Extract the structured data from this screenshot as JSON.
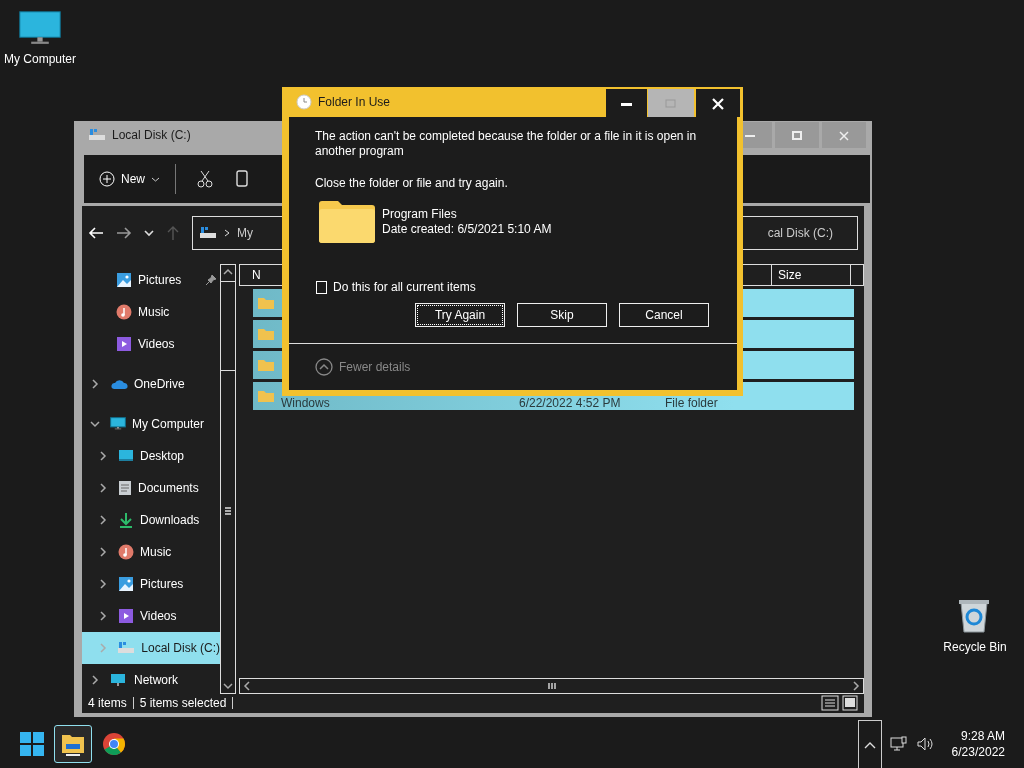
{
  "desktop_icons": [
    {
      "kind": "computer",
      "label": "My Computer"
    },
    {
      "kind": "recycle",
      "label": "Recycle Bin"
    }
  ],
  "explorer": {
    "title": "Local Disk (C:)",
    "toolbar": [
      {
        "kind": "new",
        "label": "New"
      },
      {
        "kind": "cut"
      },
      {
        "kind": "copy"
      }
    ],
    "address": {
      "left": "My",
      "right": "cal Disk (C:)"
    },
    "nav": [
      {
        "kind": "pictures",
        "label": "Pictures",
        "pinned": true,
        "selected": false
      },
      {
        "kind": "music",
        "label": "Music",
        "pinned": false,
        "selected": false
      },
      {
        "kind": "videos",
        "label": "Videos",
        "pinned": false,
        "selected": false
      },
      {
        "kind": "cloud",
        "label": "OneDrive",
        "expanded": false,
        "selected": false
      },
      {
        "kind": "computer",
        "label": "My Computer",
        "expanded": true,
        "selected": false,
        "children": [
          {
            "kind": "desktop",
            "label": "Desktop",
            "expanded": false,
            "selected": false
          },
          {
            "kind": "documents",
            "label": "Documents",
            "expanded": false,
            "selected": false
          },
          {
            "kind": "downloads",
            "label": "Downloads",
            "expanded": false,
            "selected": false
          },
          {
            "kind": "music",
            "label": "Music",
            "expanded": false,
            "selected": false
          },
          {
            "kind": "pictures",
            "label": "Pictures",
            "expanded": false,
            "selected": false
          },
          {
            "kind": "videos",
            "label": "Videos",
            "expanded": false,
            "selected": false
          },
          {
            "kind": "disk",
            "label": "Local Disk (C:)",
            "expanded": false,
            "selected": true
          }
        ]
      },
      {
        "kind": "network",
        "label": "Network",
        "expanded": false,
        "selected": false
      }
    ],
    "columns": [
      {
        "label": "N"
      },
      {
        "label": "Size"
      }
    ],
    "rows": [
      {
        "selected": true
      },
      {
        "selected": true
      },
      {
        "selected": true
      },
      {
        "selected": true,
        "name": "Windows",
        "date": "6/22/2022 4:52 PM",
        "type": "File folder"
      }
    ],
    "status_bar": {
      "count": "4 items",
      "selection": "5 items selected"
    }
  },
  "dialog": {
    "title": "Folder In Use",
    "message": "The action can't be completed because the folder or a file in it is open in another program",
    "instruction": "Close the folder or file and try again.",
    "file": {
      "name": "Program Files",
      "date": "Date created: 6/5/2021 5:10 AM"
    },
    "checkbox": {
      "label": "Do this for all current items",
      "checked": false
    },
    "buttons": [
      {
        "label": "Try Again",
        "focused": true
      },
      {
        "label": "Skip",
        "focused": false
      },
      {
        "label": "Cancel",
        "focused": false
      }
    ],
    "details_toggle": "Fewer details"
  },
  "taskbar": {
    "apps": [
      {
        "kind": "start",
        "active": false
      },
      {
        "kind": "explorer",
        "active": true
      },
      {
        "kind": "browser",
        "active": false
      }
    ],
    "time": "9:28 AM",
    "date": "6/23/2022"
  }
}
